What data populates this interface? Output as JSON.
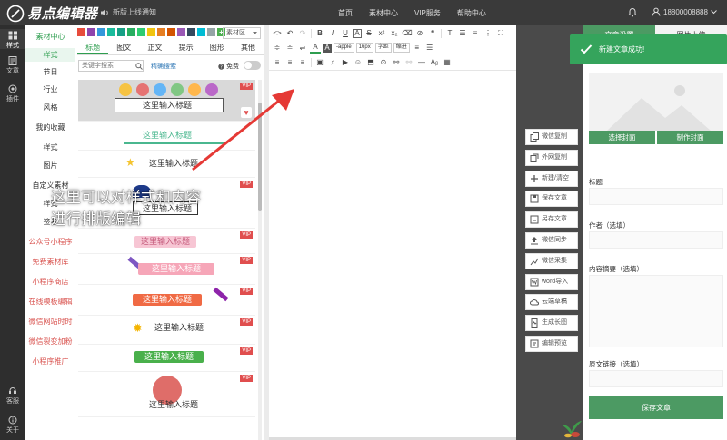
{
  "app": {
    "brand": "易点编辑器",
    "notice": "新版上线通知",
    "nav": [
      "首页",
      "素材中心",
      "VIP服务",
      "帮助中心"
    ],
    "user": "18800008888",
    "accent": "#2e9e4f"
  },
  "sidebar": {
    "items": [
      {
        "label": "样式",
        "icon": "style-icon"
      },
      {
        "label": "文章",
        "icon": "article-icon"
      },
      {
        "label": "插件",
        "icon": "plugin-icon"
      }
    ],
    "bottom": [
      {
        "label": "客服",
        "icon": "service-icon"
      },
      {
        "label": "关于",
        "icon": "info-icon"
      }
    ]
  },
  "material": {
    "categories": [
      {
        "label": "素材中心",
        "kind": "title"
      },
      {
        "label": "样式",
        "kind": "selected"
      },
      {
        "label": "节日",
        "kind": "normal"
      },
      {
        "label": "行业",
        "kind": "normal"
      },
      {
        "label": "风格",
        "kind": "normal"
      },
      {
        "label": "我的收藏",
        "kind": "title"
      },
      {
        "label": "样式",
        "kind": "normal"
      },
      {
        "label": "图片",
        "kind": "normal"
      },
      {
        "label": "自定义素材",
        "kind": "title"
      },
      {
        "label": "样式",
        "kind": "normal"
      },
      {
        "label": "签名",
        "kind": "normal"
      },
      {
        "label": "公众号小程序",
        "kind": "red"
      },
      {
        "label": "免费素材库",
        "kind": "red"
      },
      {
        "label": "小程序商店",
        "kind": "red"
      },
      {
        "label": "在线模板编辑",
        "kind": "red"
      },
      {
        "label": "微信网站时时",
        "kind": "red"
      },
      {
        "label": "微信裂变加粉",
        "kind": "red"
      },
      {
        "label": "小程序推广",
        "kind": "red"
      }
    ],
    "swatch_colors": [
      "#e74c3c",
      "#8e44ad",
      "#3498db",
      "#1abc9c",
      "#16a085",
      "#27ae60",
      "#2ecc71",
      "#f1c40f",
      "#e67e22",
      "#d35400",
      "#9b59b6",
      "#34495e",
      "#00bcd4",
      "#95a5a6"
    ],
    "material_select": "素材区",
    "tabs": [
      "标题",
      "图文",
      "正文",
      "提示",
      "图形",
      "其他"
    ],
    "search_placeholder": "关键字搜索",
    "exact_search": "精确搜索",
    "free_label": "免费",
    "vip_badge": "VIP",
    "cards": [
      {
        "title": "这里输入标题",
        "vip": true,
        "fav": true,
        "highlight": true
      },
      {
        "title": "这里输入标题",
        "vip": false,
        "fav": false,
        "highlight": false
      },
      {
        "title": "这里输入标题",
        "vip": false,
        "fav": false,
        "highlight": false
      },
      {
        "title": "这里输入标题",
        "vip": true,
        "fav": false,
        "highlight": false
      },
      {
        "title": "这里输入标题",
        "vip": true,
        "fav": false,
        "highlight": false
      },
      {
        "title": "这里输入标题",
        "vip": true,
        "fav": false,
        "highlight": false
      },
      {
        "title": "这里输入标题",
        "vip": true,
        "fav": false,
        "highlight": false
      },
      {
        "title": "这里输入标题",
        "vip": true,
        "fav": false,
        "highlight": false
      },
      {
        "title": "这里输入标题",
        "vip": true,
        "fav": false,
        "highlight": false
      },
      {
        "title": "这里输入标题",
        "vip": true,
        "fav": false,
        "highlight": false
      }
    ]
  },
  "editor": {
    "font_select": "-apple",
    "size_select": "16px",
    "spacing_select": "字距",
    "indent_select": "缩进"
  },
  "actions": [
    "微信复制",
    "外网复制",
    "新建/清空",
    "保存文章",
    "另存文章",
    "微信同步",
    "微信采集",
    "word导入",
    "云端草稿",
    "生成长图",
    "编辑预览"
  ],
  "right": {
    "tabs": [
      "文章设置",
      "图片上传"
    ],
    "cover_select": "选择封面",
    "cover_make": "制作封面",
    "title_label": "标题",
    "author_label": "作者（选填）",
    "summary_label": "内容摘要（选填）",
    "source_label": "原文链接（选填）",
    "save": "保存文章"
  },
  "toast": {
    "text": "新建文章成功!"
  },
  "overlay": {
    "line1": "这里可以对样式和内容",
    "line2": "进行排版编辑"
  }
}
